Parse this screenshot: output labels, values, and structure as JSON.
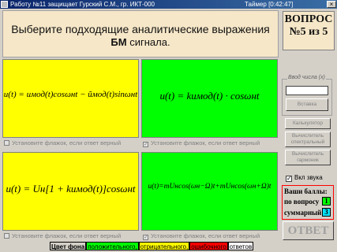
{
  "titlebar": {
    "title": "Работу №11 защищает Гурский С.М., гр. ИКТ-000",
    "timer": "Таймер [0:42:47]",
    "close": "×"
  },
  "question": {
    "line1": "Выберите подходящие аналитические выражения",
    "line2_bold": "БМ",
    "line2_rest": " сигнала."
  },
  "counter": {
    "line1": "ВОПРОС",
    "line2": "№5 из 5"
  },
  "options": [
    {
      "formula": "u(t) = uмод(t)cosωнt − ũмод(t)sinωнt",
      "checkbox": "Установите флажок, если ответ верный",
      "checked": false
    },
    {
      "formula": "u(t) = kuмод(t) · cosωнt",
      "checkbox": "Установите флажок, если ответ верный",
      "checked": true
    },
    {
      "formula": "u(t) = Uн[1 + kuмод(t)]cosωнt",
      "checkbox": "Установите флажок, если ответ верный",
      "checked": false
    },
    {
      "formula": "u(t)=mUнcos(ωн−Ω)t+mUнcos(ωн+Ω)t",
      "checkbox": "Установите флажок, если ответ верный",
      "checked": true
    }
  ],
  "side": {
    "num_legend": "Ввод числа (x)",
    "num_value": "",
    "buttons": [
      "Вставка",
      "Калькулятор",
      "Вычислитель\nспектральный",
      "Вычислитель\nгармоник"
    ],
    "sound_label": "Вкл звука",
    "sound_checked": true
  },
  "score": {
    "title": "Ваши баллы:",
    "per_question_label": "по вопросу",
    "per_question_value": "1",
    "total_label": "суммарный",
    "total_value": "3"
  },
  "answer_button": "ОТВЕТ",
  "legend": {
    "prefix": "Цвет фона",
    "positive": "положительного,",
    "negative": "отрицательного,",
    "wrong": "ошибочного",
    "answers": "ответов",
    "colors": {
      "positive": "#00ff00",
      "negative": "#ffff00",
      "wrong": "#ff0000",
      "answers": "#ffffff"
    }
  }
}
